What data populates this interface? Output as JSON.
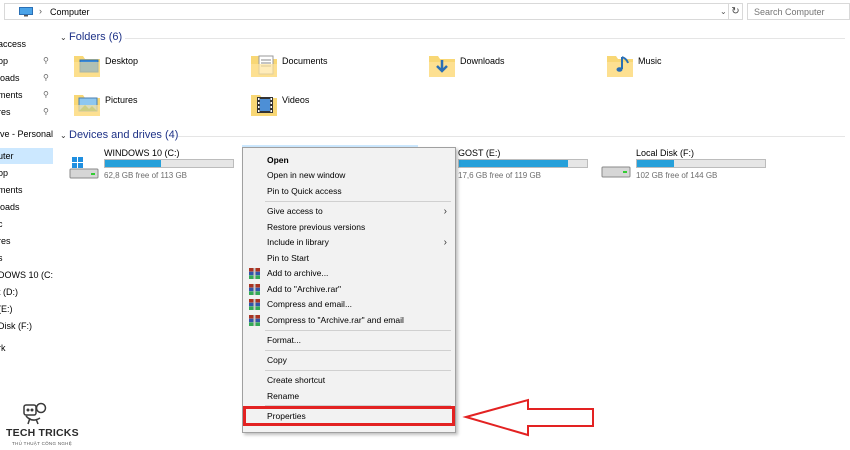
{
  "address_bar": {
    "path_separator": "›",
    "location": "Computer",
    "dropdown_glyph": "⌄",
    "refresh_glyph": "↻",
    "search_placeholder": "Search Computer"
  },
  "nav_pane": {
    "items": [
      {
        "label": "access",
        "pinned": false,
        "selected": false
      },
      {
        "label": "op",
        "pinned": true,
        "selected": false
      },
      {
        "label": "loads",
        "pinned": true,
        "selected": false
      },
      {
        "label": "ments",
        "pinned": true,
        "selected": false
      },
      {
        "label": "res",
        "pinned": true,
        "selected": false
      },
      {
        "label": "ive - Personal",
        "pinned": false,
        "selected": false
      },
      {
        "label": "uter",
        "pinned": false,
        "selected": true
      },
      {
        "label": "op",
        "pinned": false,
        "selected": false
      },
      {
        "label": "ments",
        "pinned": false,
        "selected": false
      },
      {
        "label": "loads",
        "pinned": false,
        "selected": false
      },
      {
        "label": "c",
        "pinned": false,
        "selected": false
      },
      {
        "label": "res",
        "pinned": false,
        "selected": false
      },
      {
        "label": "s",
        "pinned": false,
        "selected": false
      },
      {
        "label": "DOWS 10 (C:)",
        "pinned": false,
        "selected": false
      },
      {
        "label": "t (D:)",
        "pinned": false,
        "selected": false
      },
      {
        "label": "(E:)",
        "pinned": false,
        "selected": false
      },
      {
        "label": "Disk (F:)",
        "pinned": false,
        "selected": false
      },
      {
        "label": "rk",
        "pinned": false,
        "selected": false
      }
    ],
    "pin_glyph": "📌"
  },
  "folders_group": {
    "header": "Folders (6)",
    "items": [
      {
        "label": "Desktop",
        "icon": "desktop-folder-icon"
      },
      {
        "label": "Documents",
        "icon": "documents-folder-icon"
      },
      {
        "label": "Downloads",
        "icon": "downloads-folder-icon"
      },
      {
        "label": "Music",
        "icon": "music-folder-icon"
      },
      {
        "label": "Pictures",
        "icon": "pictures-folder-icon"
      },
      {
        "label": "Videos",
        "icon": "videos-folder-icon"
      }
    ]
  },
  "drives_group": {
    "header": "Devices and drives (4)",
    "items": [
      {
        "name": "WINDOWS 10 (C:)",
        "free": "62,8 GB free of 113 GB",
        "used_fraction": 0.44,
        "icon": "windows-drive-icon"
      },
      {
        "name": "",
        "free": "",
        "used_fraction": 0.5,
        "icon": "drive-icon"
      },
      {
        "name": "GOST (E:)",
        "free": "17,6 GB free of 119 GB",
        "used_fraction": 0.85,
        "icon": "drive-icon"
      },
      {
        "name": "Local Disk (F:)",
        "free": "102 GB free of 144 GB",
        "used_fraction": 0.29,
        "icon": "drive-icon"
      }
    ]
  },
  "context_menu": {
    "items": [
      {
        "label": "Open",
        "bold": true
      },
      {
        "label": "Open in new window"
      },
      {
        "label": "Pin to Quick access"
      },
      {
        "separator": true
      },
      {
        "label": "Give access to",
        "submenu": true
      },
      {
        "label": "Restore previous versions"
      },
      {
        "label": "Include in library",
        "submenu": true
      },
      {
        "label": "Pin to Start"
      },
      {
        "label": "Add to archive...",
        "icon": "winrar-icon"
      },
      {
        "label": "Add to \"Archive.rar\"",
        "icon": "winrar-icon"
      },
      {
        "label": "Compress and email...",
        "icon": "winrar-icon"
      },
      {
        "label": "Compress to \"Archive.rar\" and email",
        "icon": "winrar-icon"
      },
      {
        "separator": true
      },
      {
        "label": "Format..."
      },
      {
        "separator": true
      },
      {
        "label": "Copy"
      },
      {
        "separator": true
      },
      {
        "label": "Create shortcut"
      },
      {
        "label": "Rename"
      },
      {
        "separator": true
      },
      {
        "label": "Properties",
        "highlighted": true
      }
    ],
    "submenu_glyph": "›"
  },
  "annotation": {
    "color": "#e32222"
  },
  "watermark": {
    "title": "TECH TRICKS",
    "subtitle": "THỦ THUẬT CÔNG NGHỆ"
  },
  "colors": {
    "accent": "#26a0da",
    "group_header": "#1e3287",
    "selected": "#cce8ff",
    "folder": "#f8d775"
  }
}
